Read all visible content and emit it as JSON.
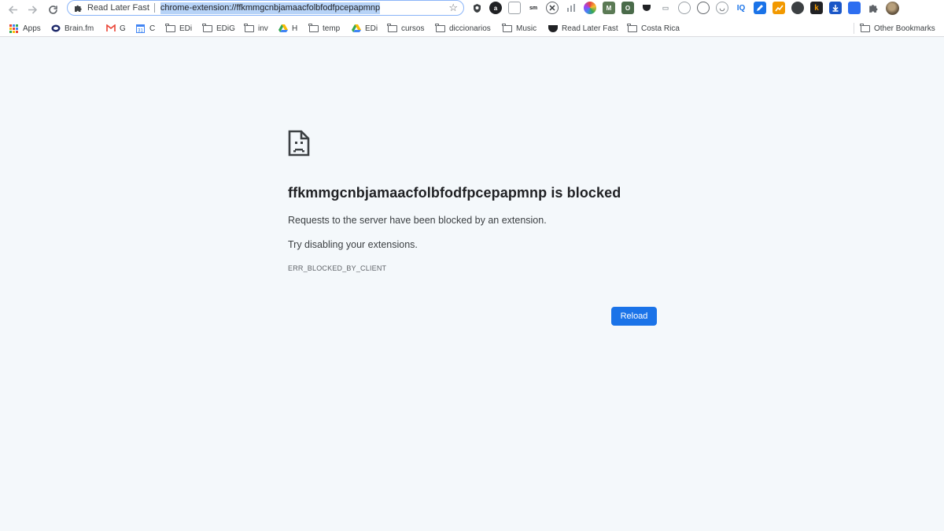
{
  "browser": {
    "omnibox": {
      "chip_label": "Read Later Fast",
      "url": "chrome-extension://ffkmmgcnbjamaacfolbfodfpcepapmnp"
    },
    "nav": {
      "back_icon": "back-arrow-icon",
      "forward_icon": "forward-arrow-icon",
      "reload_icon": "reload-icon",
      "star_icon": "bookmark-star-icon"
    },
    "extensions": [
      {
        "name": "shield-extension-icon",
        "text": "",
        "bg": "#3c4043"
      },
      {
        "name": "circle-a-extension-icon",
        "text": "a",
        "bg": "#202124"
      },
      {
        "name": "cube-extension-icon",
        "text": "",
        "bg": "#ffffff"
      },
      {
        "name": "sm-extension-icon",
        "text": "sm",
        "bg": "#ffffff"
      },
      {
        "name": "x-extension-icon",
        "text": "",
        "bg": "#ffffff"
      },
      {
        "name": "bars-extension-icon",
        "text": "",
        "bg": "#ffffff"
      },
      {
        "name": "color-wheel-extension-icon",
        "text": "",
        "bg": "#e8453c"
      },
      {
        "name": "m-extension-icon",
        "text": "M",
        "bg": "#5b7a55"
      },
      {
        "name": "o-extension-icon",
        "text": "O",
        "bg": "#4a6b4a"
      },
      {
        "name": "pocket-extension-icon",
        "text": "",
        "bg": "#202124"
      },
      {
        "name": "bed-extension-icon",
        "text": "",
        "bg": "#ffffff"
      },
      {
        "name": "compass-extension-icon",
        "text": "",
        "bg": "#ffffff"
      },
      {
        "name": "globe-extension-icon",
        "text": "",
        "bg": "#ffffff"
      },
      {
        "name": "cat-extension-icon",
        "text": "",
        "bg": "#ffffff"
      },
      {
        "name": "iq-extension-icon",
        "text": "IQ",
        "bg": "#ffffff"
      },
      {
        "name": "edit-extension-icon",
        "text": "",
        "bg": "#1a73e8"
      },
      {
        "name": "chart-extension-icon",
        "text": "",
        "bg": "#f29900"
      },
      {
        "name": "cloud-extension-icon",
        "text": "",
        "bg": "#3c4043"
      },
      {
        "name": "k-extension-icon",
        "text": "k",
        "bg": "#202124"
      },
      {
        "name": "download-extension-icon",
        "text": "",
        "bg": "#1a56c7"
      },
      {
        "name": "blue-app-extension-icon",
        "text": "",
        "bg": "#2d6ef0"
      },
      {
        "name": "puzzle-extensions-icon",
        "text": "",
        "bg": "#ffffff"
      }
    ]
  },
  "bookmarks": {
    "items": [
      {
        "label": "Apps",
        "icon": "apps-grid-icon"
      },
      {
        "label": "Brain.fm",
        "icon": "brainfm-icon"
      },
      {
        "label": "G",
        "icon": "gmail-icon"
      },
      {
        "label": "C",
        "icon": "calendar-icon"
      },
      {
        "label": "EDi",
        "icon": "folder-icon"
      },
      {
        "label": "EDiG",
        "icon": "folder-icon"
      },
      {
        "label": "inv",
        "icon": "folder-icon"
      },
      {
        "label": "H",
        "icon": "drive-icon"
      },
      {
        "label": "temp",
        "icon": "folder-icon"
      },
      {
        "label": "EDi",
        "icon": "drive-icon"
      },
      {
        "label": "cursos",
        "icon": "folder-icon"
      },
      {
        "label": "diccionarios",
        "icon": "folder-icon"
      },
      {
        "label": "Music",
        "icon": "folder-icon"
      },
      {
        "label": "Read Later Fast",
        "icon": "read-later-icon"
      },
      {
        "label": "Costa Rica",
        "icon": "folder-icon"
      }
    ],
    "other_label": "Other Bookmarks"
  },
  "page": {
    "icon": "sad-document-icon",
    "headline": "ffkmmgcnbjamaacfolbfodfpcepapmnp is blocked",
    "message": "Requests to the server have been blocked by an extension.",
    "suggestion": "Try disabling your extensions.",
    "error_code": "ERR_BLOCKED_BY_CLIENT",
    "reload_label": "Reload"
  },
  "colors": {
    "page_background": "#f4f8fb",
    "accent_button": "#1a73e8",
    "url_selection": "#b7d3f7"
  }
}
